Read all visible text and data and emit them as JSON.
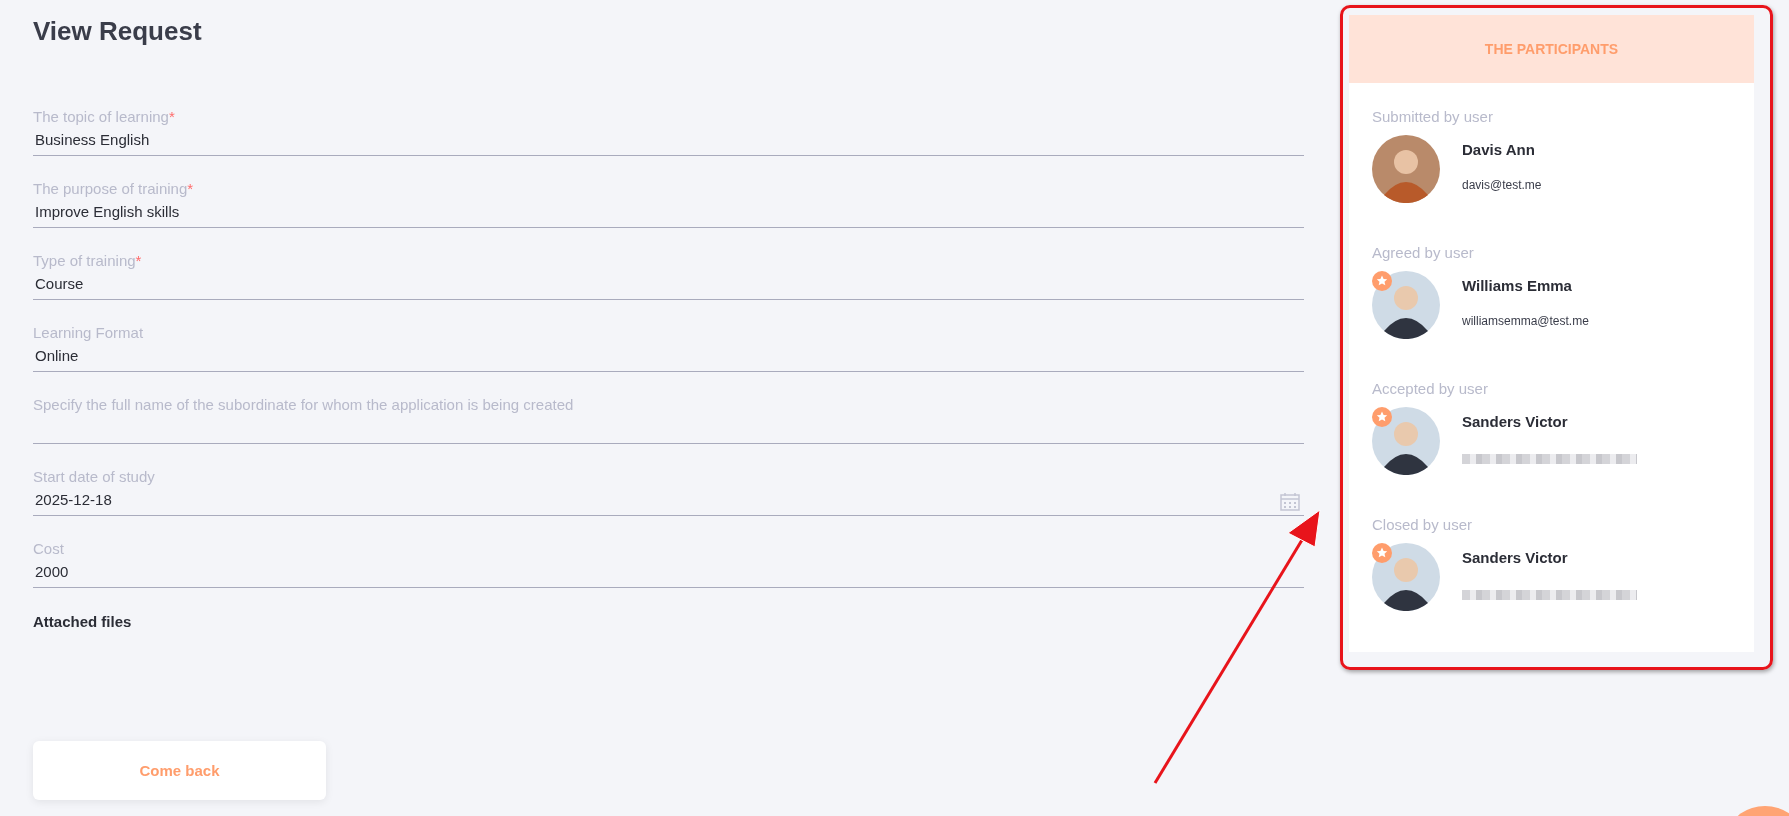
{
  "page": {
    "title": "View Request"
  },
  "required_mark": "*",
  "fields": [
    {
      "label": "The topic of learning",
      "required": true,
      "value": "Business English",
      "kind": "text"
    },
    {
      "label": "The purpose of training",
      "required": true,
      "value": "Improve English skills",
      "kind": "text"
    },
    {
      "label": "Type of training",
      "required": true,
      "value": "Course",
      "kind": "text"
    },
    {
      "label": "Learning Format",
      "required": false,
      "value": "Online",
      "kind": "text"
    },
    {
      "label": "Specify the full name of the subordinate for whom the application is being created",
      "required": false,
      "kind": "text"
    },
    {
      "label": "Start date of study",
      "required": false,
      "value": "2025-12-18",
      "kind": "date"
    },
    {
      "label": "Cost",
      "required": false,
      "value": "2000",
      "kind": "text"
    }
  ],
  "attachments": {
    "title": "Attached files"
  },
  "back_button": {
    "label": "Come back"
  },
  "participants": {
    "title": "THE PARTICIPANTS",
    "items": [
      {
        "role": "Submitted by user",
        "name": "Davis Ann",
        "email": "davis@test.me",
        "starred": false,
        "redacted": false
      },
      {
        "role": "Agreed by user",
        "name": "Williams Emma",
        "email": "williamsemma@test.me",
        "starred": true,
        "redacted": false
      },
      {
        "role": "Accepted by user",
        "name": "Sanders Victor",
        "starred": true,
        "redacted": true
      },
      {
        "role": "Closed by user",
        "name": "Sanders Victor",
        "starred": true,
        "redacted": true
      }
    ]
  }
}
